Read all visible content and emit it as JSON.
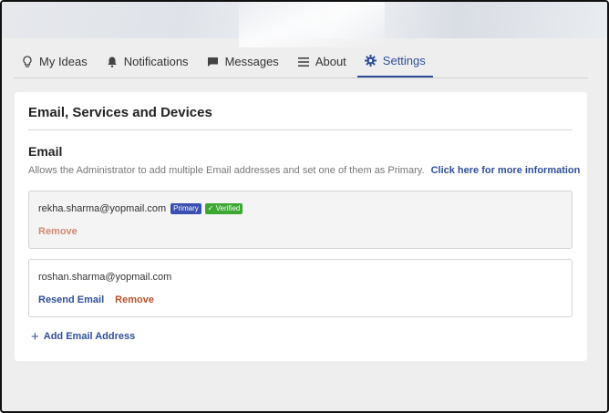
{
  "colors": {
    "accent": "#2f4f9a",
    "primary_badge": "#3a4fb0",
    "verified_badge": "#3ca832",
    "remove": "#b5532c"
  },
  "tabs": [
    {
      "label": "My Ideas",
      "icon": "lightbulb-icon"
    },
    {
      "label": "Notifications",
      "icon": "bell-icon"
    },
    {
      "label": "Messages",
      "icon": "message-icon"
    },
    {
      "label": "About",
      "icon": "menu-lines-icon"
    },
    {
      "label": "Settings",
      "icon": "gear-icon",
      "active": true
    }
  ],
  "card": {
    "title": "Email, Services and Devices"
  },
  "email_section": {
    "title": "Email",
    "description": "Allows the Administrator to add multiple Email addresses and set one of them as Primary.",
    "info_link": "Click here for more information",
    "emails": [
      {
        "address": "rekha.sharma@yopmail.com",
        "primary_badge": "Primary",
        "verified_badge": "✓ Verified",
        "remove_label": "Remove"
      },
      {
        "address": "roshan.sharma@yopmail.com",
        "resend_label": "Resend Email",
        "remove_label": "Remove"
      }
    ],
    "add_label": "Add Email Address"
  }
}
